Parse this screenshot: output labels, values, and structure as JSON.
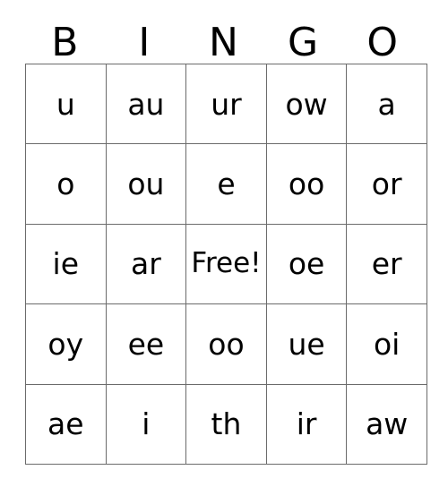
{
  "card": {
    "title": "BINGO",
    "headers": [
      "B",
      "I",
      "N",
      "G",
      "O"
    ],
    "free_space_label": "Free!",
    "free_space_position": {
      "row": 3,
      "column": 3
    },
    "colors": {
      "background": "#ffffff",
      "grid_line": "#6b6b6b",
      "text": "#000000"
    },
    "rows": [
      {
        "cells": [
          "u",
          "au",
          "ur",
          "ow",
          "a"
        ]
      },
      {
        "cells": [
          "o",
          "ou",
          "e",
          "oo",
          "or"
        ]
      },
      {
        "cells": [
          "ie",
          "ar",
          "Free!",
          "oe",
          "er"
        ]
      },
      {
        "cells": [
          "oy",
          "ee",
          "oo",
          "ue",
          "oi"
        ]
      },
      {
        "cells": [
          "ae",
          "i",
          "th",
          "ir",
          "aw"
        ]
      }
    ],
    "columns": {
      "B": [
        "u",
        "o",
        "ie",
        "oy",
        "ae"
      ],
      "I": [
        "au",
        "ou",
        "ar",
        "ee",
        "i"
      ],
      "N": [
        "ur",
        "e",
        "Free!",
        "oo",
        "th"
      ],
      "G": [
        "ow",
        "oo",
        "oe",
        "ue",
        "ir"
      ],
      "O": [
        "a",
        "or",
        "er",
        "oi",
        "aw"
      ]
    }
  }
}
